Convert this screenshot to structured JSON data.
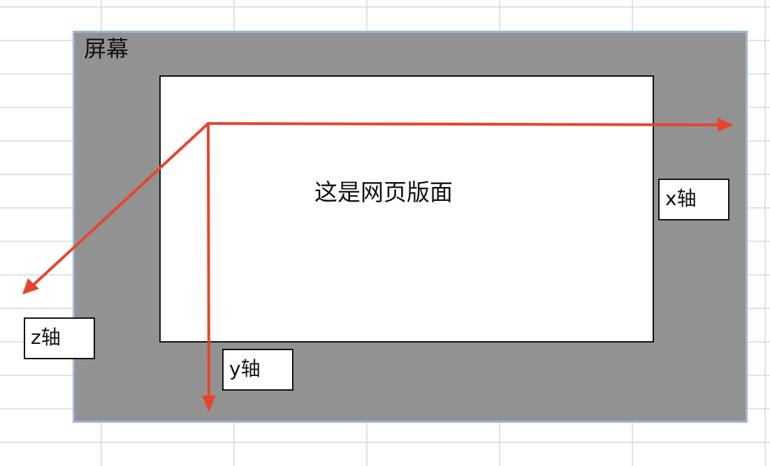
{
  "screen": {
    "label": "屏幕",
    "fill": "#929292",
    "border_color": "#9bb6d6"
  },
  "page": {
    "label": "这是网页版面"
  },
  "axes": {
    "x_label": "x轴",
    "y_label": "y轴",
    "z_label": "z轴",
    "arrow_color": "#e8442d"
  },
  "background": {
    "grid_color": "#d9d9d9"
  }
}
